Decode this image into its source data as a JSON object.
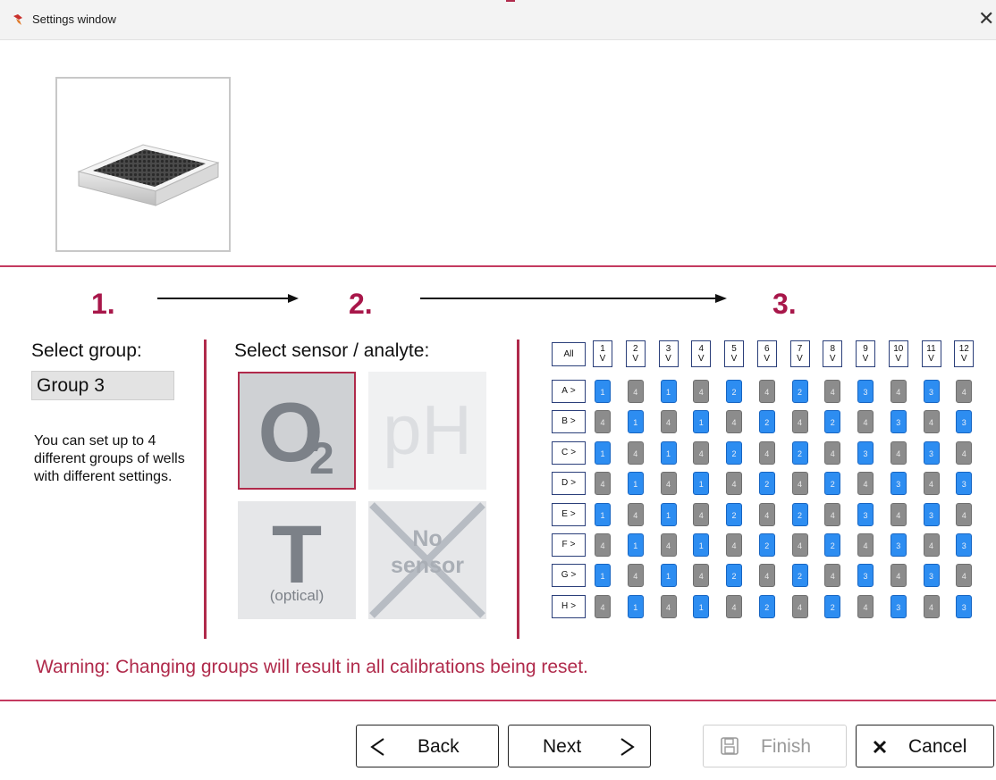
{
  "window": {
    "title": "Settings window",
    "close_glyph": "✕"
  },
  "steps": {
    "s1": "1.",
    "s2": "2.",
    "s3": "3."
  },
  "group": {
    "heading": "Select group:",
    "value": "Group 3",
    "help": "You can set up to 4 different groups of wells with different settings."
  },
  "sensor": {
    "heading": "Select sensor / analyte:",
    "tiles": [
      {
        "id": "o2",
        "main": "O",
        "sub": "2",
        "selected": true,
        "disabled": false
      },
      {
        "id": "ph",
        "main": "pH",
        "selected": false,
        "disabled": true
      },
      {
        "id": "t",
        "main": "T",
        "caption": "(optical)",
        "selected": false,
        "disabled": false
      },
      {
        "id": "none",
        "line1": "No",
        "line2": "sensor",
        "selected": false,
        "disabled": false
      }
    ]
  },
  "plate": {
    "all_label": "All",
    "columns": [
      "1",
      "2",
      "3",
      "4",
      "5",
      "6",
      "7",
      "8",
      "9",
      "10",
      "11",
      "12"
    ],
    "col_suffix": "V",
    "rows": [
      "A",
      "B",
      "C",
      "D",
      "E",
      "F",
      "G",
      "H"
    ],
    "row_suffix": ">",
    "wells": [
      [
        1,
        4,
        1,
        4,
        2,
        4,
        2,
        4,
        3,
        4,
        3,
        4
      ],
      [
        4,
        1,
        4,
        1,
        4,
        2,
        4,
        2,
        4,
        3,
        4,
        3
      ],
      [
        1,
        4,
        1,
        4,
        2,
        4,
        2,
        4,
        3,
        4,
        3,
        4
      ],
      [
        4,
        1,
        4,
        1,
        4,
        2,
        4,
        2,
        4,
        3,
        4,
        3
      ],
      [
        1,
        4,
        1,
        4,
        2,
        4,
        2,
        4,
        3,
        4,
        3,
        4
      ],
      [
        4,
        1,
        4,
        1,
        4,
        2,
        4,
        2,
        4,
        3,
        4,
        3
      ],
      [
        1,
        4,
        1,
        4,
        2,
        4,
        2,
        4,
        3,
        4,
        3,
        4
      ],
      [
        4,
        1,
        4,
        1,
        4,
        2,
        4,
        2,
        4,
        3,
        4,
        3
      ]
    ]
  },
  "warning": "Warning: Changing groups will result in all calibrations being reset.",
  "buttons": {
    "back": "Back",
    "next": "Next",
    "finish": "Finish",
    "finish_enabled": false,
    "cancel": "Cancel"
  },
  "colors": {
    "accent": "#b02a4b",
    "well_blue": "#2d8df1",
    "well_gray": "#8c8c8c"
  }
}
